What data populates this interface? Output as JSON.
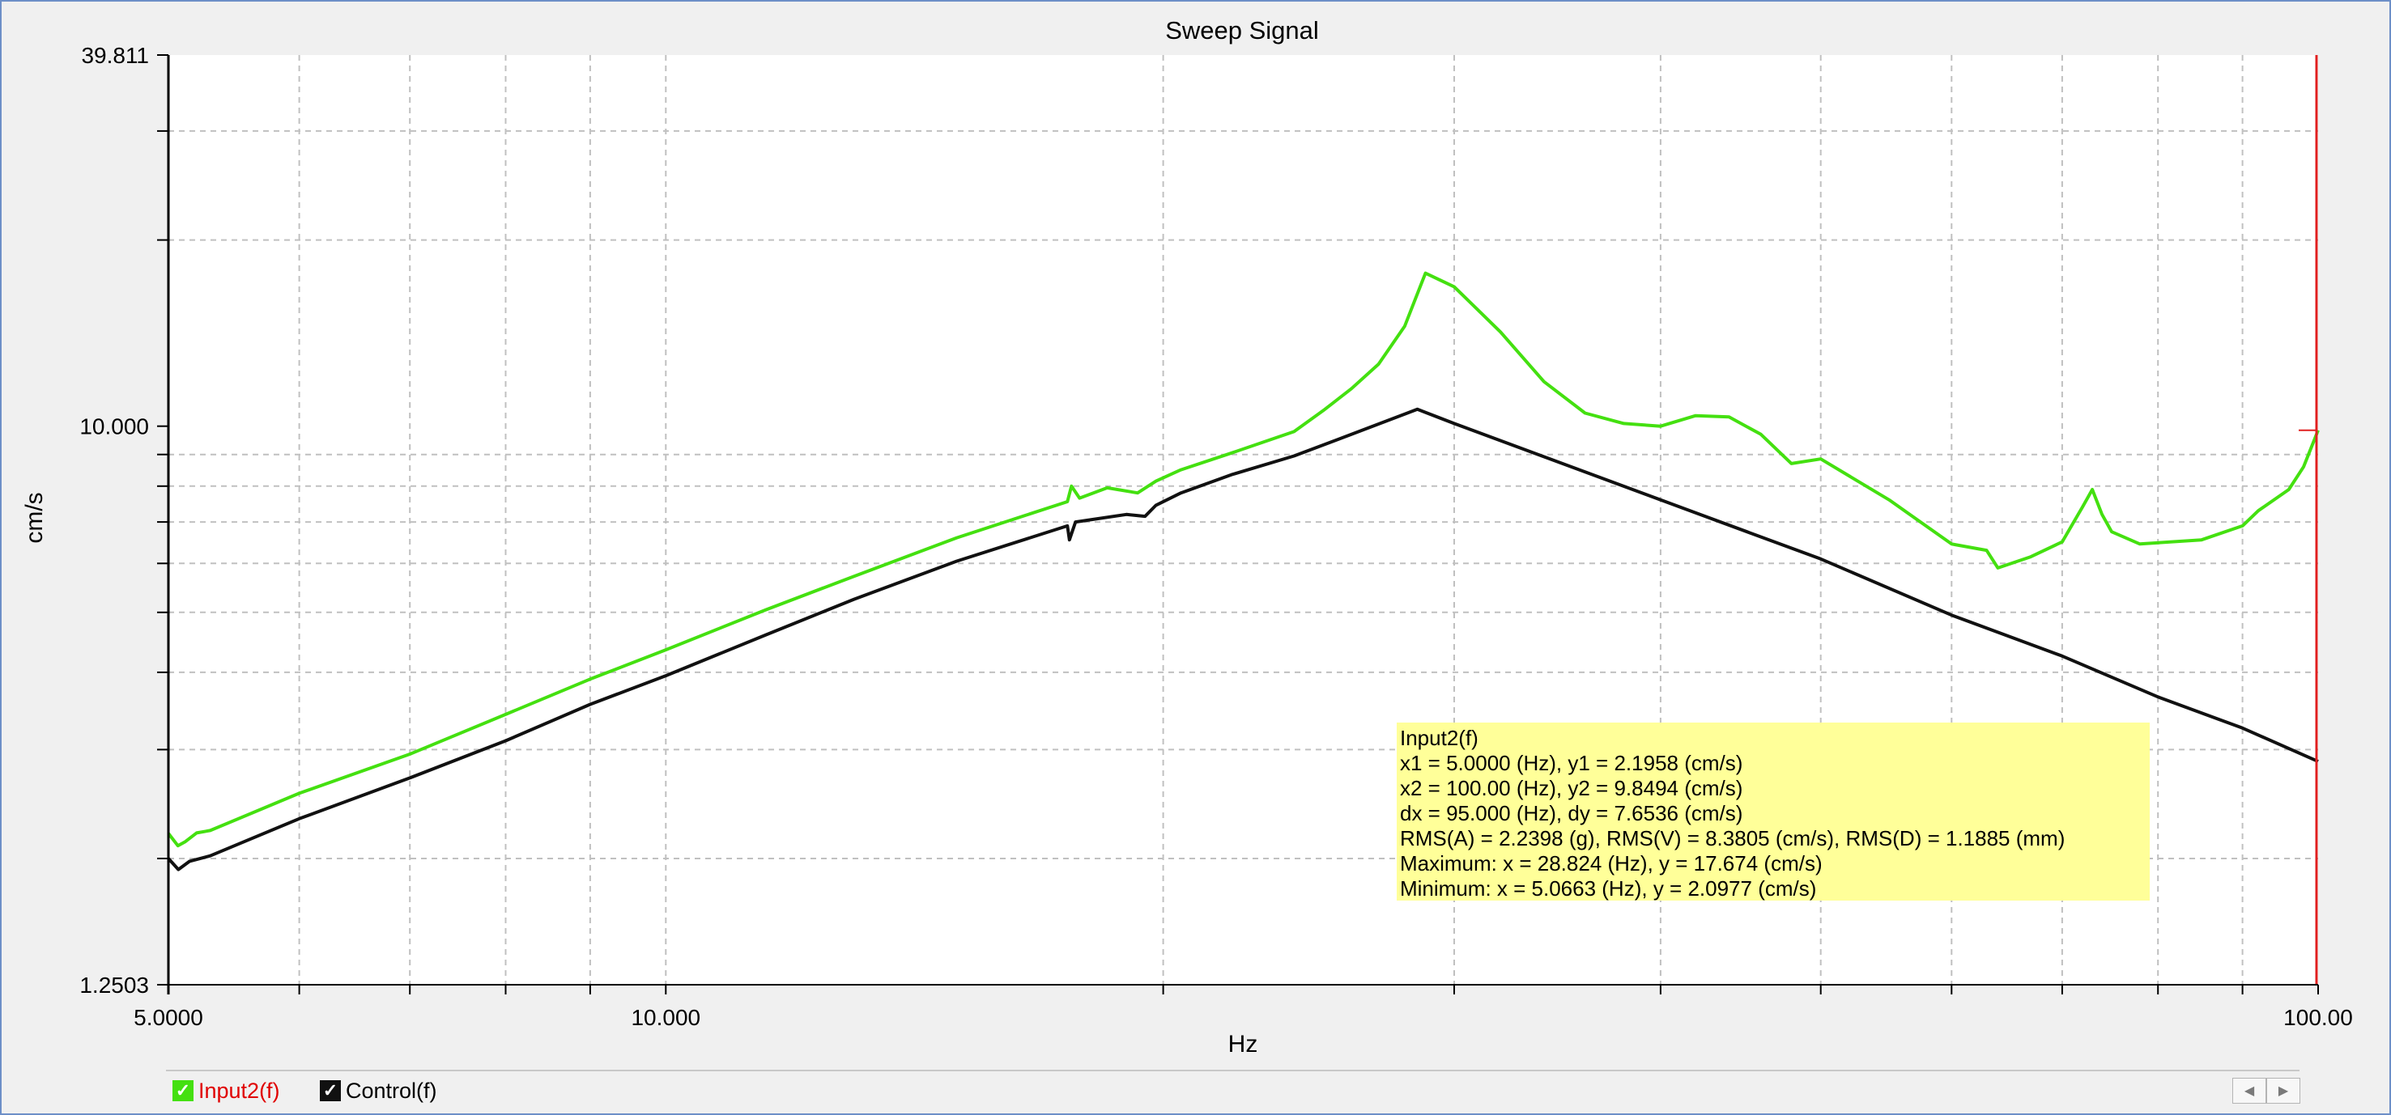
{
  "colors": {
    "input2": "#44e010",
    "control": "#111111",
    "cursor": "#e02020",
    "grid": "#c0c0c0",
    "readout_bg": "#ffff99",
    "legend_label_active": "#e00000"
  },
  "chart_data": {
    "type": "line",
    "title": "Sweep Signal",
    "xlabel": "Hz",
    "ylabel": "cm/s",
    "x_scale": "log",
    "y_scale": "log",
    "xlim": [
      5.0,
      100.0
    ],
    "ylim": [
      1.2503,
      39.811
    ],
    "x_tick_labels": [
      {
        "value": 5.0,
        "label": "5.0000"
      },
      {
        "value": 10.0,
        "label": "10.000"
      },
      {
        "value": 100.0,
        "label": "100.00"
      }
    ],
    "y_tick_labels": [
      {
        "value": 39.811,
        "label": "39.811"
      },
      {
        "value": 10.0,
        "label": "10.000"
      },
      {
        "value": 1.2503,
        "label": "1.2503"
      }
    ],
    "x_gridlines": [
      6,
      7,
      8,
      9,
      10,
      20,
      30,
      40,
      50,
      60,
      70,
      80,
      90
    ],
    "y_gridlines": [
      2,
      3,
      4,
      5,
      6,
      7,
      8,
      9,
      20,
      30
    ],
    "grid": true,
    "cursor_x": 100.0,
    "series": [
      {
        "name": "Input2(f)",
        "color_key": "input2",
        "points": [
          [
            5.0,
            2.1958
          ],
          [
            5.0663,
            2.0977
          ],
          [
            5.12,
            2.13
          ],
          [
            5.2,
            2.2
          ],
          [
            5.3,
            2.22
          ],
          [
            6.0,
            2.55
          ],
          [
            7.0,
            2.95
          ],
          [
            8.0,
            3.42
          ],
          [
            9.0,
            3.9
          ],
          [
            10.0,
            4.35
          ],
          [
            11.5,
            5.05
          ],
          [
            13.0,
            5.72
          ],
          [
            15.0,
            6.6
          ],
          [
            17.5,
            7.55
          ],
          [
            17.6,
            8.0
          ],
          [
            17.8,
            7.65
          ],
          [
            18.5,
            7.95
          ],
          [
            19.3,
            7.8
          ],
          [
            19.8,
            8.15
          ],
          [
            20.5,
            8.5
          ],
          [
            22.0,
            9.05
          ],
          [
            24.0,
            9.8
          ],
          [
            25.0,
            10.6
          ],
          [
            26.0,
            11.5
          ],
          [
            27.0,
            12.6
          ],
          [
            28.0,
            14.5
          ],
          [
            28.824,
            17.674
          ],
          [
            30.0,
            16.8
          ],
          [
            32.0,
            14.2
          ],
          [
            34.0,
            11.8
          ],
          [
            36.0,
            10.5
          ],
          [
            38.0,
            10.1
          ],
          [
            40.0,
            10.0
          ],
          [
            42.0,
            10.4
          ],
          [
            44.0,
            10.35
          ],
          [
            46.0,
            9.7
          ],
          [
            48.0,
            8.7
          ],
          [
            50.0,
            8.85
          ],
          [
            55.0,
            7.6
          ],
          [
            60.0,
            6.45
          ],
          [
            63.0,
            6.3
          ],
          [
            64.0,
            5.9
          ],
          [
            67.0,
            6.15
          ],
          [
            70.0,
            6.5
          ],
          [
            72.0,
            7.4
          ],
          [
            73.0,
            7.9
          ],
          [
            74.0,
            7.2
          ],
          [
            75.0,
            6.75
          ],
          [
            78.0,
            6.45
          ],
          [
            85.0,
            6.55
          ],
          [
            90.0,
            6.9
          ],
          [
            92.0,
            7.3
          ],
          [
            96.0,
            7.9
          ],
          [
            98.0,
            8.6
          ],
          [
            100.0,
            9.8494
          ]
        ]
      },
      {
        "name": "Control(f)",
        "color_key": "control",
        "points": [
          [
            5.0,
            2.0
          ],
          [
            5.07,
            1.92
          ],
          [
            5.15,
            1.98
          ],
          [
            5.3,
            2.02
          ],
          [
            6.0,
            2.32
          ],
          [
            7.0,
            2.7
          ],
          [
            8.0,
            3.1
          ],
          [
            9.0,
            3.55
          ],
          [
            10.0,
            3.95
          ],
          [
            11.5,
            4.6
          ],
          [
            13.0,
            5.25
          ],
          [
            15.0,
            6.05
          ],
          [
            17.5,
            6.9
          ],
          [
            17.55,
            6.55
          ],
          [
            17.7,
            7.0
          ],
          [
            19.0,
            7.2
          ],
          [
            19.5,
            7.15
          ],
          [
            19.8,
            7.45
          ],
          [
            20.5,
            7.8
          ],
          [
            22.0,
            8.35
          ],
          [
            24.0,
            8.95
          ],
          [
            26.0,
            9.7
          ],
          [
            28.5,
            10.65
          ],
          [
            30.0,
            10.1
          ],
          [
            40.0,
            7.6
          ],
          [
            50.0,
            6.1
          ],
          [
            60.0,
            4.95
          ],
          [
            70.0,
            4.25
          ],
          [
            80.0,
            3.65
          ],
          [
            90.0,
            3.25
          ],
          [
            100.0,
            2.87
          ]
        ]
      }
    ]
  },
  "readout": {
    "title": "Input2(f)",
    "line1": "x1 = 5.0000 (Hz), y1 = 2.1958 (cm/s)",
    "line2": "x2 = 100.00 (Hz), y2 = 9.8494 (cm/s)",
    "line3": "dx = 95.000 (Hz), dy = 7.6536 (cm/s)",
    "line4": "RMS(A) = 2.2398 (g), RMS(V) = 8.3805 (cm/s), RMS(D) = 1.1885 (mm)",
    "line5": "Maximum: x = 28.824 (Hz), y = 17.674 (cm/s)",
    "line6": "Minimum: x = 5.0663 (Hz), y = 2.0977 (cm/s)"
  },
  "legend": {
    "input2_label": "Input2(f)",
    "control_label": "Control(f)"
  },
  "icons": {
    "checkbox": "checkmark-icon",
    "scroll_left": "triangle-left-icon",
    "scroll_right": "triangle-right-icon"
  }
}
